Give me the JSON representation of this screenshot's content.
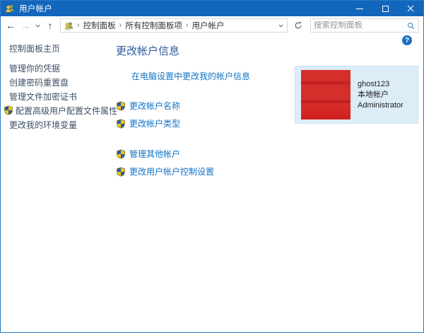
{
  "window": {
    "title": "用户帐户"
  },
  "icons": {
    "app": "users-icon",
    "back_glyph": "←",
    "forward_glyph": "→",
    "up_glyph": "↑",
    "help_glyph": "?"
  },
  "navbar": {
    "breadcrumb": {
      "separator": "›",
      "segments": [
        "控制面板",
        "所有控制面板项",
        "用户帐户"
      ]
    },
    "search": {
      "placeholder": "搜索控制面板"
    }
  },
  "sidebar": {
    "items": [
      {
        "label": "控制面板主页"
      },
      {
        "label": "管理你的凭据"
      },
      {
        "label": "创建密码重置盘"
      },
      {
        "label": "管理文件加密证书"
      },
      {
        "label": "配置高级用户配置文件属性",
        "shield": true
      },
      {
        "label": "更改我的环境变量"
      }
    ]
  },
  "main": {
    "heading": "更改帐户信息",
    "pc_settings_link": "在电脑设置中更改我的帐户信息",
    "tasks_group1": [
      "更改帐户名称",
      "更改帐户类型"
    ],
    "tasks_group2": [
      "管理其他帐户",
      "更改用户帐户控制设置"
    ]
  },
  "account": {
    "name": "ghost123",
    "type": "本地帐户",
    "role": "Administrator"
  },
  "colors": {
    "titlebar": "#1266bb",
    "link": "#1174c5",
    "sidebar_link": "#3d5166",
    "heading": "#2b5a9e",
    "panel_bg": "#dcedf8",
    "avatar_red": "#d62e2b"
  }
}
